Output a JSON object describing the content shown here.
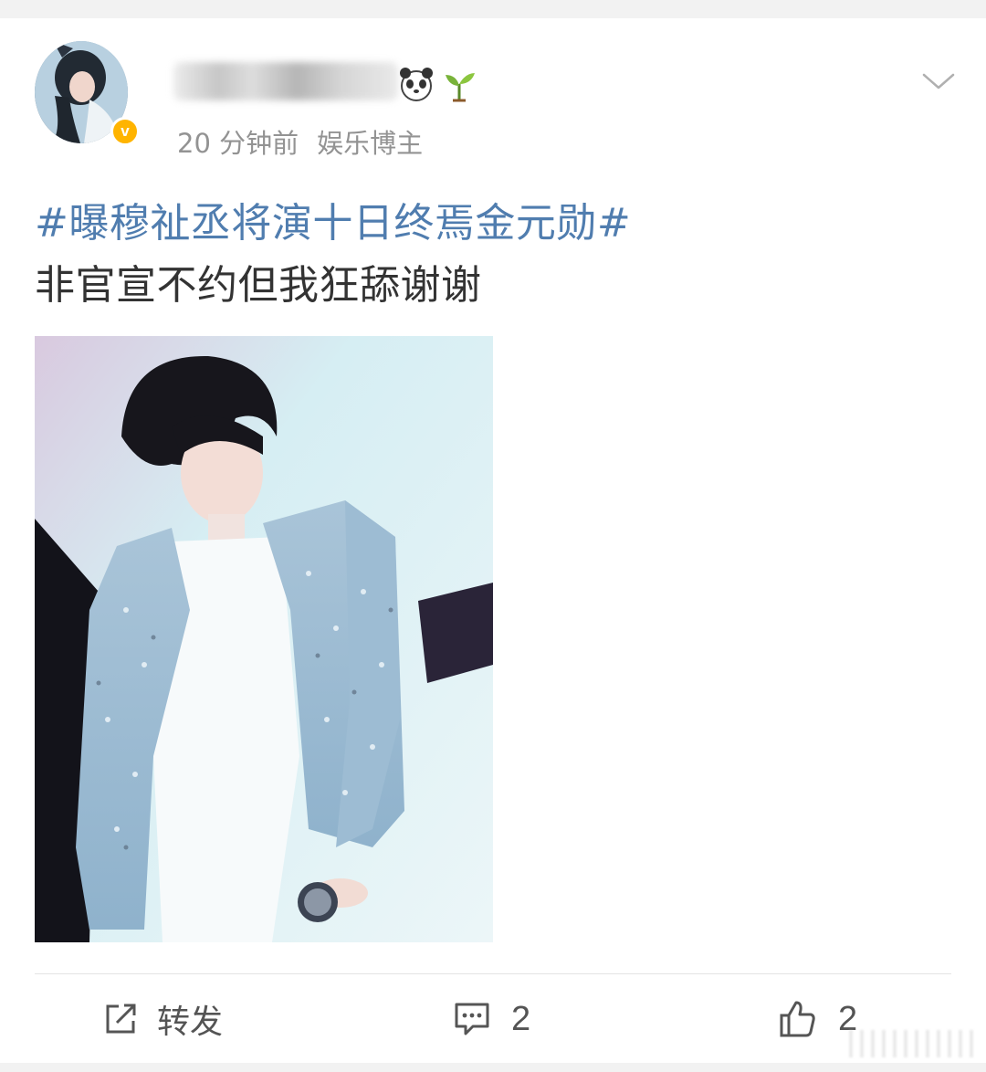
{
  "post": {
    "meta": {
      "time": "20 分钟前",
      "source": "娱乐博主"
    },
    "verified_mark": "v",
    "topic": "#曝穆祉丞将演十日终焉金元勋#",
    "text": "非官宣不约但我狂舔谢谢"
  },
  "actions": {
    "repost_label": "转发",
    "comment_count": "2",
    "like_count": "2"
  },
  "colors": {
    "topic_link": "#507daf",
    "verified_badge": "#ffb400",
    "text_primary": "#333333",
    "text_secondary": "#939393"
  },
  "icons": [
    "panda-badge-icon",
    "sprout-badge-icon",
    "chevron-down-icon",
    "repost-icon",
    "comment-icon",
    "like-icon"
  ]
}
